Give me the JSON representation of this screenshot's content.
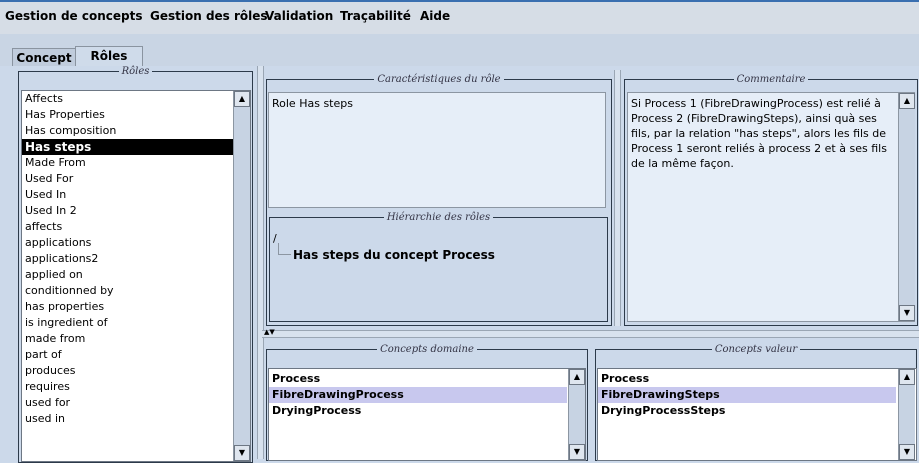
{
  "menu": {
    "items": [
      "Gestion de concepts",
      "Gestion des rôles",
      "Validation",
      "Traçabilité",
      "Aide"
    ]
  },
  "tabs": [
    "Concept",
    "Rôles"
  ],
  "roles_panel": {
    "legend": "Rôles",
    "items": [
      "Affects",
      "Has Properties",
      "Has composition",
      "Has steps",
      "Made From",
      "Used For",
      "Used In",
      "Used In 2",
      "affects",
      "applications",
      "applications2",
      "applied on",
      "conditionned by",
      "has properties",
      "is ingredient of",
      "made from",
      "part of",
      "produces",
      "requires",
      "used for",
      "used in"
    ],
    "selected": "Has steps"
  },
  "characteristics": {
    "legend": "Caractéristiques du rôle",
    "text": "Role Has steps"
  },
  "hierarchy": {
    "legend": "Hiérarchie des rôles",
    "root": "/",
    "node": "Has steps du concept Process"
  },
  "comment": {
    "legend": "Commentaire",
    "text": "Si Process 1 (FibreDrawingProcess) est relié à Process 2 (FibreDrawingSteps), ainsi quà ses fils, par la relation \"has steps\", alors les fils de Process 1 seront reliés à process 2 et à ses fils de la même façon."
  },
  "domain_concepts": {
    "legend": "Concepts domaine",
    "items": [
      "Process",
      "FibreDrawingProcess",
      "DryingProcess"
    ],
    "highlighted": "FibreDrawingProcess"
  },
  "value_concepts": {
    "legend": "Concepts valeur",
    "items": [
      "Process",
      "FibreDrawingSteps",
      "DryingProcessSteps"
    ],
    "highlighted": "FibreDrawingSteps"
  },
  "colors": {
    "accent": "#3a6fb0",
    "selection": "#000000",
    "highlight": "#c8c8ee"
  }
}
